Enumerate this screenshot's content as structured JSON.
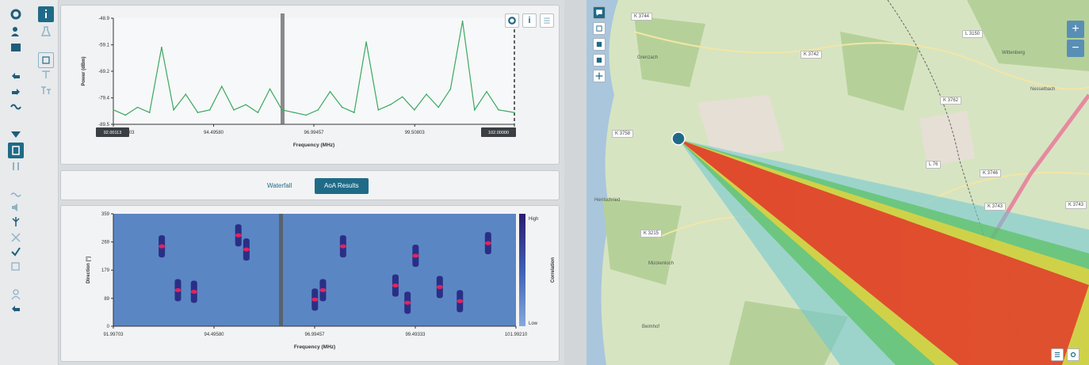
{
  "toolbar": {
    "icons": [
      "gear-icon",
      "person-icon",
      "image-icon",
      "undo-icon",
      "redo-icon",
      "wave-icon",
      "filter-icon",
      "report-icon",
      "info-icon",
      "antenna-icon",
      "list-icon",
      "bars-icon"
    ]
  },
  "spectrum": {
    "ylabel": "Power (dBm)",
    "xlabel": "Frequency (MHz)",
    "y_ticks": [
      "-48.9",
      "-59.1",
      "-69.2",
      "-79.4",
      "-89.5"
    ],
    "x_ticks": [
      "91.99703",
      "94.49580",
      "96.99457",
      "99.50803",
      "101.99210"
    ],
    "range_start_badge": "92.00113",
    "range_end_badge": "102.00000",
    "tools": [
      "gear-icon",
      "info-icon",
      "list-icon"
    ],
    "info_label": "i"
  },
  "tabs": {
    "waterfall": "Waterfall",
    "aoa": "AoA Results"
  },
  "aoa": {
    "ylabel": "Direction [°]",
    "xlabel": "Frequency (MHz)",
    "y_ticks": [
      "359",
      "269",
      "179",
      "89",
      "0"
    ],
    "x_ticks": [
      "91.99703",
      "94.49580",
      "96.99457",
      "99.49333",
      "101.99210"
    ],
    "colorbar_high": "High",
    "colorbar_low": "Low",
    "colorbar_label": "Correlation"
  },
  "chart_data": [
    {
      "type": "line",
      "title": "",
      "xlabel": "Frequency (MHz)",
      "ylabel": "Power (dBm)",
      "xlim": [
        91.99703,
        101.9921
      ],
      "ylim": [
        -89.5,
        -48.9
      ],
      "series": [
        {
          "x": [
            92.0,
            92.3,
            92.6,
            92.9,
            93.2,
            93.5,
            93.8,
            94.1,
            94.4,
            94.7,
            95.0,
            95.3,
            95.6,
            95.9,
            96.2,
            96.5,
            96.8,
            97.1,
            97.4,
            97.7,
            98.0,
            98.3,
            98.6,
            98.9,
            99.2,
            99.5,
            99.8,
            100.1,
            100.4,
            100.7,
            101.0,
            101.3,
            101.6,
            101.99
          ],
          "y": [
            -84,
            -86,
            -83,
            -85,
            -60,
            -84,
            -78,
            -85,
            -84,
            -75,
            -84,
            -82,
            -85,
            -76,
            -84,
            -85,
            -86,
            -84,
            -77,
            -83,
            -85,
            -58,
            -84,
            -82,
            -79,
            -84,
            -78,
            -83,
            -76,
            -50,
            -84,
            -77,
            -84,
            -85
          ]
        }
      ]
    },
    {
      "type": "heatmap",
      "title": "",
      "xlabel": "Frequency (MHz)",
      "ylabel": "Direction [°]",
      "xlim": [
        91.99703,
        101.9921
      ],
      "ylim": [
        0,
        359
      ],
      "series": [
        {
          "name": "",
          "x": [
            93.2,
            93.6,
            94.0,
            95.1,
            95.3,
            97.0,
            97.2,
            97.7,
            99.0,
            99.3,
            99.5,
            100.1,
            100.6,
            101.3
          ],
          "y": [
            255,
            115,
            110,
            290,
            245,
            85,
            115,
            255,
            130,
            75,
            225,
            125,
            80,
            265
          ]
        }
      ]
    }
  ],
  "map": {
    "road_labels": [
      "K 3744",
      "K 3742",
      "L 3150",
      "K 3762",
      "K 3758",
      "L 76",
      "K 3746",
      "K 3743",
      "K 3743",
      "K 3215"
    ],
    "place_labels": [
      "Grenzach",
      "Herrischried",
      "Mückenloch",
      "Beimhof",
      "Wittenberg",
      "Nesselbach"
    ],
    "controls": [
      "comment-icon",
      "layers-icon",
      "stack-icon",
      "stack2-icon",
      "crosshair-icon"
    ],
    "zoom_in": "+",
    "zoom_out": "−"
  }
}
